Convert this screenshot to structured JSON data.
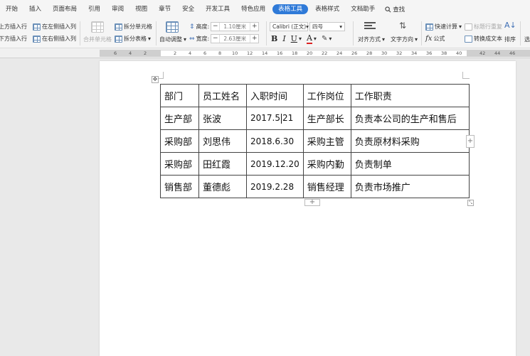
{
  "menu": {
    "items": [
      "开始",
      "插入",
      "页面布局",
      "引用",
      "审阅",
      "视图",
      "章节",
      "安全",
      "开发工具",
      "特色应用",
      "表格工具",
      "表格样式",
      "文档助手"
    ],
    "active_index": 10,
    "search": "查找"
  },
  "ribbon": {
    "insert_above": "上方插入行",
    "insert_below": "下方插入行",
    "insert_left": "在左侧插入列",
    "insert_right": "在右侧插入列",
    "merge_cells": "合并单元格",
    "split_cells": "拆分单元格",
    "split_table": "拆分表格",
    "autofit": "自动调整",
    "height_label": "高度:",
    "height_value": "1.10厘米",
    "width_label": "宽度:",
    "width_value": "2.63厘米",
    "font_name": "Calibri (正文)",
    "font_size": "四号",
    "bold": "B",
    "italic": "I",
    "underline": "U",
    "font_color": "A",
    "align": "对齐方式",
    "text_direction": "文字方向",
    "quick_calc": "快速计算",
    "title_repeat": "标题行重复",
    "formula": "公式",
    "formula_fx": "fx",
    "convert_text": "转换成文本",
    "sort": "排序",
    "more": "选"
  },
  "ruler": {
    "labels": [
      "6",
      "4",
      "2",
      "2",
      "4",
      "6",
      "8",
      "10",
      "12",
      "14",
      "16",
      "18",
      "20",
      "22",
      "24",
      "26",
      "28",
      "30",
      "32",
      "34",
      "36",
      "38",
      "40",
      "42",
      "44",
      "46"
    ]
  },
  "table": {
    "rows": [
      [
        "部门",
        "员工姓名",
        "入职时间",
        "工作岗位",
        "工作职责"
      ],
      [
        "生产部",
        "张波",
        "2017.5.21",
        "生产部长",
        "负责本公司的生产和售后"
      ],
      [
        "采购部",
        "刘思伟",
        "2018.6.30",
        "采购主管",
        "负责原材料采购"
      ],
      [
        "采购部",
        "田红霞",
        "2019.12.20",
        "采购内勤",
        "负责制单"
      ],
      [
        "销售部",
        "董德彪",
        "2019.2.28",
        "销售经理",
        "负责市场推广"
      ]
    ],
    "caret_before": "2017.5",
    "caret_after": "21"
  },
  "colors": {
    "accent": "#2f7ad8",
    "workspace": "#e9e9e9"
  }
}
